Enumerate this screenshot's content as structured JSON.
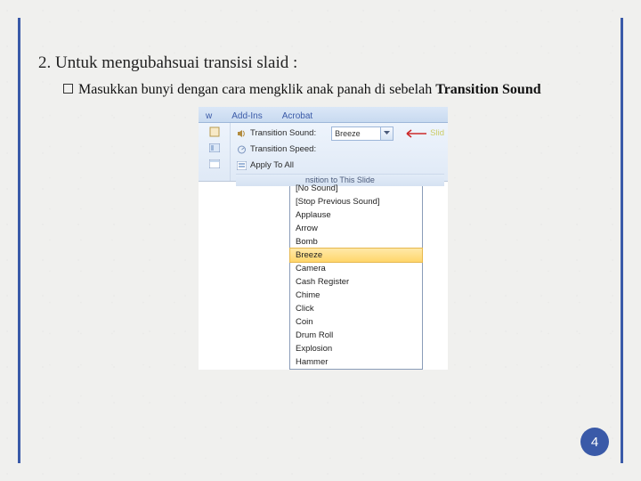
{
  "heading": "2. Untuk mengubahsuai transisi slaid :",
  "bullet": {
    "lead": "Masukkan bunyi dengan cara mengklik anak panah di sebelah ",
    "bold": "Transition Sound"
  },
  "ribbon": {
    "tabs": [
      "w",
      "Add-Ins",
      "Acrobat"
    ],
    "sound_label": "Transition Sound:",
    "sound_value": "Breeze",
    "speed_label": "Transition Speed:",
    "speed_value": "",
    "apply_label": "Apply To All",
    "group_caption": "nsition to This Slide",
    "right_hint": "Slid"
  },
  "dropdown": {
    "items": [
      "[No Sound]",
      "[Stop Previous Sound]",
      "Applause",
      "Arrow",
      "Bomb",
      "Breeze",
      "Camera",
      "Cash Register",
      "Chime",
      "Click",
      "Coin",
      "Drum Roll",
      "Explosion",
      "Hammer"
    ],
    "selected_index": 5
  },
  "page_number": "4"
}
